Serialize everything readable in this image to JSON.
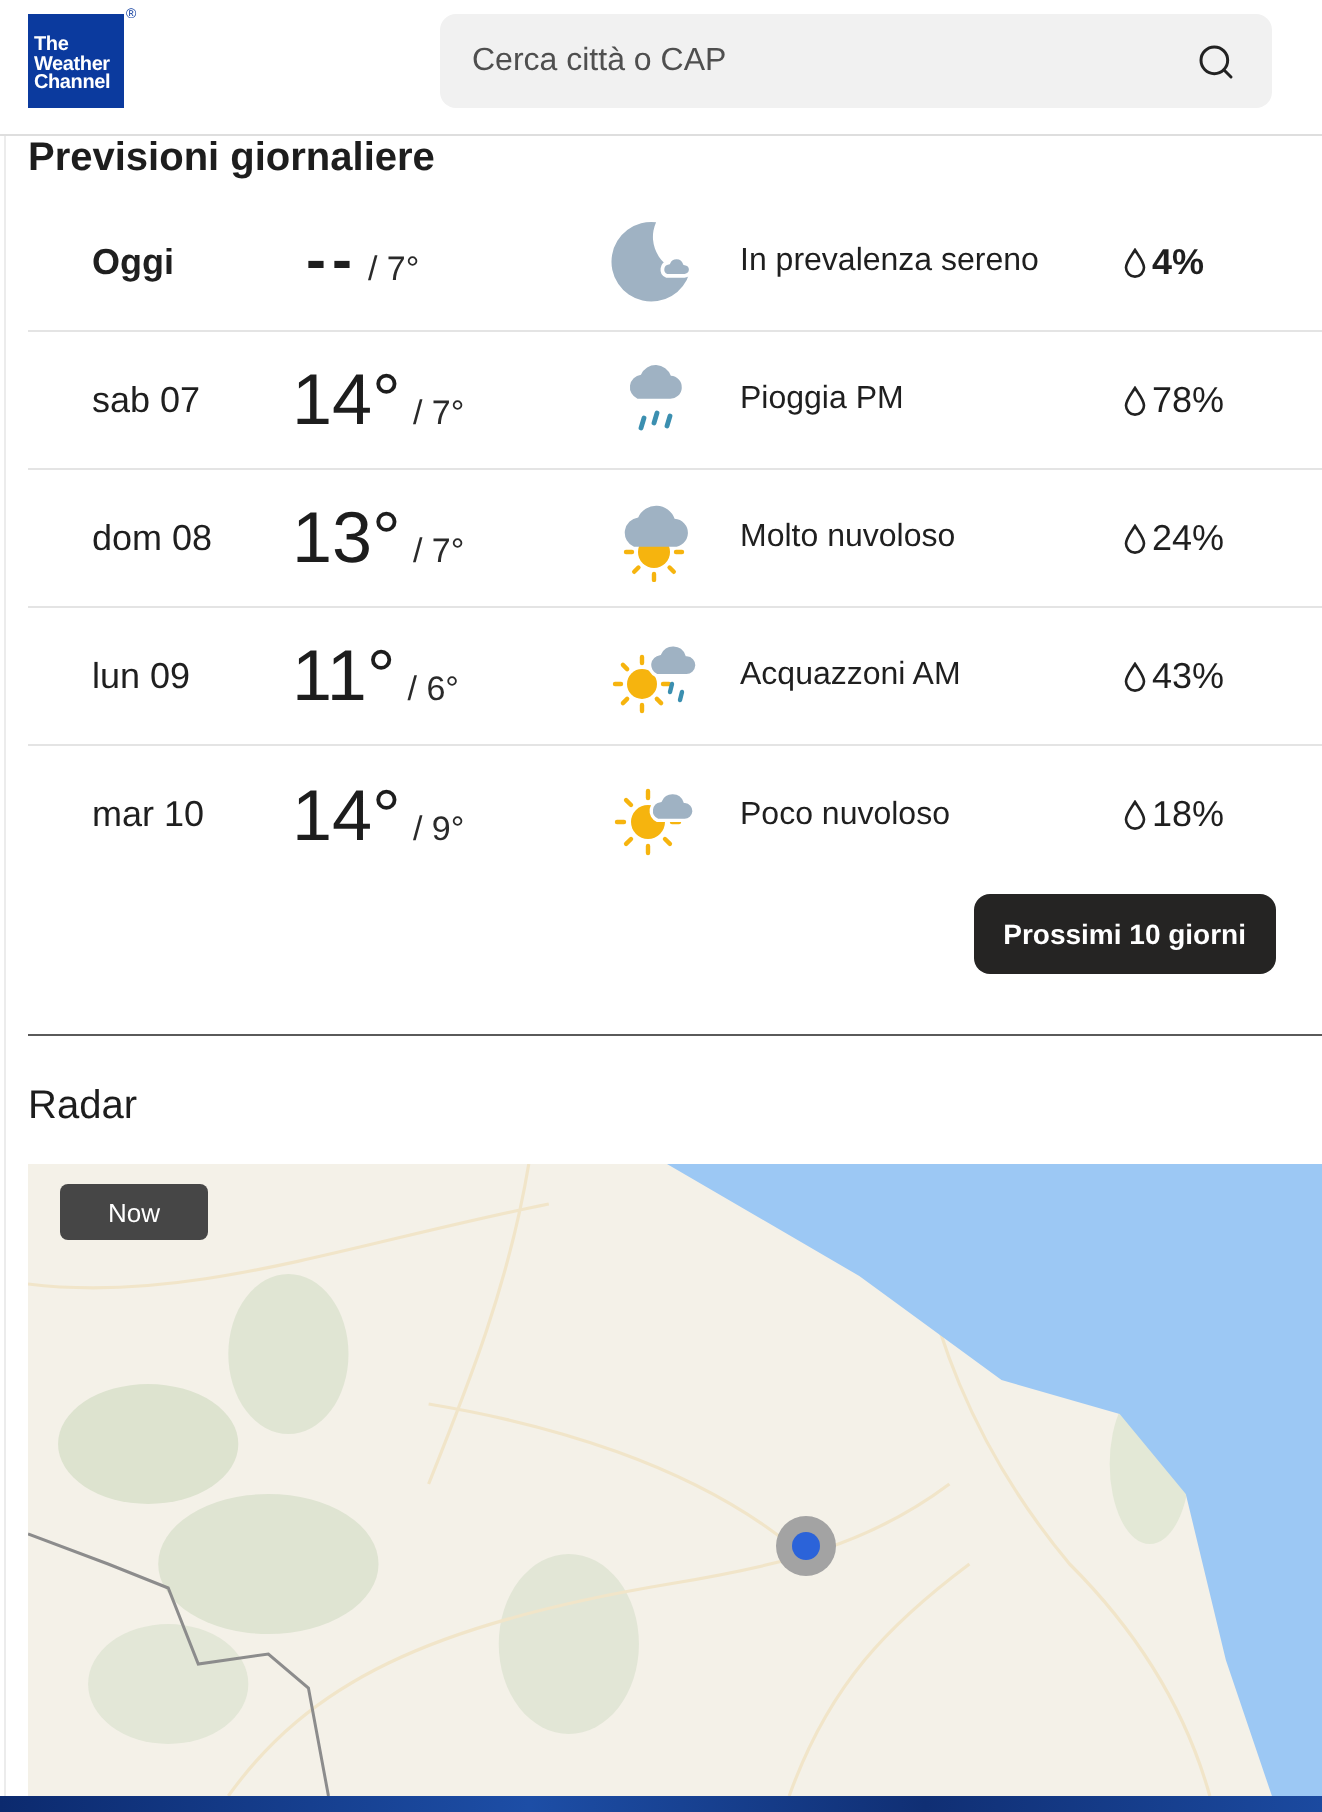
{
  "header": {
    "logo": {
      "text": "The Weather Channel",
      "mark": "®"
    },
    "search": {
      "placeholder": "Cerca città o CAP"
    }
  },
  "daily_forecast": {
    "title": "Previsioni giornaliere",
    "days": [
      {
        "kind": "today",
        "day": "Oggi",
        "high": "--",
        "low": "/ 7°",
        "condition": "In prevalenza sereno",
        "precip": "4%"
      },
      {
        "kind": "day",
        "day": "sab 07",
        "high": "14°",
        "low": "/ 7°",
        "condition": "Pioggia PM",
        "precip": "78%"
      },
      {
        "kind": "day",
        "day": "dom 08",
        "high": "13°",
        "low": "/ 7°",
        "condition": "Molto nuvoloso",
        "precip": "24%"
      },
      {
        "kind": "day",
        "day": "lun 09",
        "high": "11°",
        "low": "/ 6°",
        "condition": "Acquazzoni AM",
        "precip": "43%"
      },
      {
        "kind": "day",
        "day": "mar 10",
        "high": "14°",
        "low": "/ 9°",
        "condition": "Poco nuvoloso",
        "precip": "18%"
      }
    ],
    "more_button": "Prossimi 10 giorni"
  },
  "radar": {
    "title": "Radar",
    "time_badge": "Now"
  }
}
